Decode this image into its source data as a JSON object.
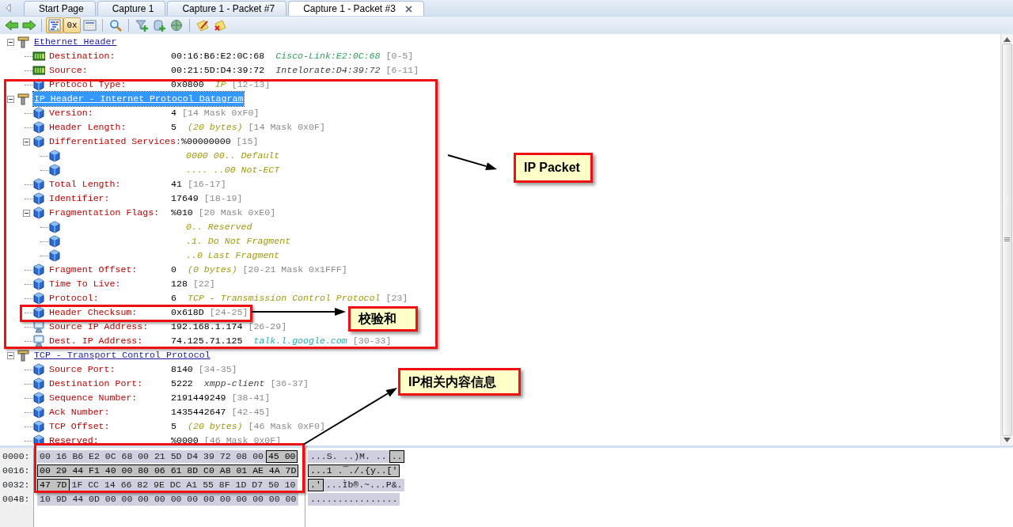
{
  "tabs": [
    {
      "label": "Start Page",
      "selected": false
    },
    {
      "label": "Capture 1",
      "selected": false
    },
    {
      "label": "Capture 1 - Packet #7",
      "selected": false
    },
    {
      "label": "Capture 1 - Packet #3",
      "selected": true
    }
  ],
  "toolbar": {
    "groups": [
      {
        "buttons": [
          {
            "kind": "back",
            "selected": false
          },
          {
            "kind": "forward",
            "selected": false
          }
        ]
      },
      {
        "buttons": [
          {
            "kind": "decode",
            "selected": true
          },
          {
            "kind": "hex",
            "label": "0x",
            "selected": true
          },
          {
            "kind": "hexview",
            "selected": false
          }
        ]
      },
      {
        "buttons": [
          {
            "kind": "find",
            "selected": false
          }
        ]
      },
      {
        "buttons": [
          {
            "kind": "filter",
            "selected": false
          },
          {
            "kind": "database",
            "selected": false
          },
          {
            "kind": "network",
            "selected": false
          }
        ]
      },
      {
        "buttons": [
          {
            "kind": "note",
            "selected": false
          },
          {
            "kind": "delete-note",
            "selected": false
          }
        ]
      }
    ]
  },
  "tree": [
    {
      "kind": "section",
      "label": "Ethernet Header",
      "expanded": true,
      "selected": false,
      "children": [
        {
          "kind": "address",
          "label": "Destination:",
          "value": "00:16:B6:E2:0C:68",
          "note": {
            "text": "Cisco-Link:E2:0C:68",
            "color": "#2ea05a"
          },
          "range": "[0-5]",
          "selected": false
        },
        {
          "kind": "address",
          "label": "Source:",
          "value": "00:21:5D:D4:39:72",
          "note": {
            "text": "Intelorate:D4:39:72",
            "color": "#404040"
          },
          "range": "[6-11]",
          "selected": false
        },
        {
          "kind": "field",
          "label": "Protocol Type:",
          "value": "0x0800",
          "note": {
            "text": "IP",
            "color": "#a09a10"
          },
          "range": "[12-13]",
          "selected": false
        }
      ]
    },
    {
      "kind": "section",
      "label": "IP Header - Internet Protocol Datagram",
      "expanded": true,
      "selected": true,
      "children": [
        {
          "kind": "field",
          "label": "Version:",
          "value": "4",
          "range": "[14 Mask 0xF0]",
          "selected": false
        },
        {
          "kind": "field",
          "label": "Header Length:",
          "value": "5",
          "note": {
            "text": "(20 bytes)",
            "color": "#a09a10"
          },
          "range": "[14 Mask 0x0F]",
          "selected": false
        },
        {
          "kind": "field",
          "label": "Differentiated Services:",
          "value": "%00000000",
          "range": "[15]",
          "expanded": true,
          "selected": false,
          "children": [
            {
              "kind": "bits",
              "value": "0000 00.. Default",
              "selected": false
            },
            {
              "kind": "bits",
              "value": ".... ..00 Not-ECT",
              "selected": false
            }
          ]
        },
        {
          "kind": "field",
          "label": "Total Length:",
          "value": "41",
          "range": "[16-17]",
          "selected": false
        },
        {
          "kind": "field",
          "label": "Identifier:",
          "value": "17649",
          "range": "[18-19]",
          "selected": false
        },
        {
          "kind": "field",
          "label": "Fragmentation Flags:",
          "value": "%010",
          "range": "[20 Mask 0xE0]",
          "expanded": true,
          "selected": false,
          "children": [
            {
              "kind": "bits",
              "value": "0.. Reserved",
              "selected": false
            },
            {
              "kind": "bits",
              "value": ".1. Do Not Fragment",
              "selected": false
            },
            {
              "kind": "bits",
              "value": "..0 Last Fragment",
              "selected": false
            }
          ]
        },
        {
          "kind": "field",
          "label": "Fragment Offset:",
          "value": "0",
          "note": {
            "text": "(0 bytes)",
            "color": "#a09a10"
          },
          "range": "[20-21 Mask 0x1FFF]",
          "selected": false
        },
        {
          "kind": "field",
          "label": "Time To Live:",
          "value": "128",
          "range": "[22]",
          "selected": false
        },
        {
          "kind": "field",
          "label": "Protocol:",
          "value": "6",
          "note": {
            "text": "TCP - Transmission Control Protocol",
            "color": "#a09a10"
          },
          "range": "[23]",
          "selected": false
        },
        {
          "kind": "field",
          "label": "Header Checksum:",
          "value": "0x618D",
          "range": "[24-25]",
          "selected": false
        },
        {
          "kind": "host",
          "label": "Source IP Address:",
          "value": "192.168.1.174",
          "range": "[26-29]",
          "selected": false
        },
        {
          "kind": "host",
          "label": "Dest. IP Address:",
          "value": "74.125.71.125",
          "note": {
            "text": "talk.l.google.com",
            "color": "#20b0b8"
          },
          "range": "[30-33]",
          "selected": false
        }
      ]
    },
    {
      "kind": "section",
      "label": "TCP - Transport Control Protocol",
      "expanded": true,
      "selected": false,
      "children": [
        {
          "kind": "field",
          "label": "Source Port:",
          "value": "8140",
          "range": "[34-35]",
          "selected": false
        },
        {
          "kind": "field",
          "label": "Destination Port:",
          "value": "5222",
          "note": {
            "text": "xmpp-client",
            "color": "#404040"
          },
          "range": "[36-37]",
          "selected": false
        },
        {
          "kind": "field",
          "label": "Sequence Number:",
          "value": "2191449249",
          "range": "[38-41]",
          "selected": false
        },
        {
          "kind": "field",
          "label": "Ack Number:",
          "value": "1435442647",
          "range": "[42-45]",
          "selected": false
        },
        {
          "kind": "field",
          "label": "TCP Offset:",
          "value": "5",
          "note": {
            "text": "(20 bytes)",
            "color": "#a09a10"
          },
          "range": "[46 Mask 0xF0]",
          "selected": false
        },
        {
          "kind": "field",
          "label": "Reserved:",
          "value": "%0000",
          "range": "[46 Mask 0x0F]",
          "selected": false
        }
      ]
    }
  ],
  "hex": [
    {
      "offset": "0000:",
      "bytes": [
        {
          "text": "00 16 B6 E2 0C 68 00 21 5D D4 39 72 08 00",
          "selected": false
        },
        {
          "text": "45 00",
          "selected": true
        }
      ],
      "ascii": [
        {
          "text": "...S. ..)M. ..",
          "selected": false
        },
        {
          "text": "..",
          "selected": true
        }
      ]
    },
    {
      "offset": "0016:",
      "bytes": [
        {
          "text": "00 29 44 F1 40 00 80 06 61 8D C0 A8 01 AE 4A 7D",
          "selected": true
        }
      ],
      "ascii": [
        {
          "text": "...1 .¯./.{y..['",
          "selected": true
        }
      ]
    },
    {
      "offset": "0032:",
      "bytes": [
        {
          "text": "47 7D",
          "selected": true
        },
        {
          "text": "1F CC 14 66 82 9E DC A1 55 8F 1D D7 50 10",
          "selected": false
        }
      ],
      "ascii": [
        {
          "text": ".'",
          "selected": true
        },
        {
          "text": "...Ìb®.~...P&.",
          "selected": false
        }
      ]
    },
    {
      "offset": "0048:",
      "bytes": [
        {
          "text": "10 9D 44 0D 00 00 00 00 00 00 00 00 00 00 00 00",
          "selected": false
        }
      ],
      "ascii": [
        {
          "text": "................",
          "selected": false
        }
      ]
    }
  ],
  "annotations": {
    "callouts": [
      {
        "text": "IP Packet"
      },
      {
        "text": "校验和"
      },
      {
        "text": "IP相关内容信息"
      }
    ]
  }
}
